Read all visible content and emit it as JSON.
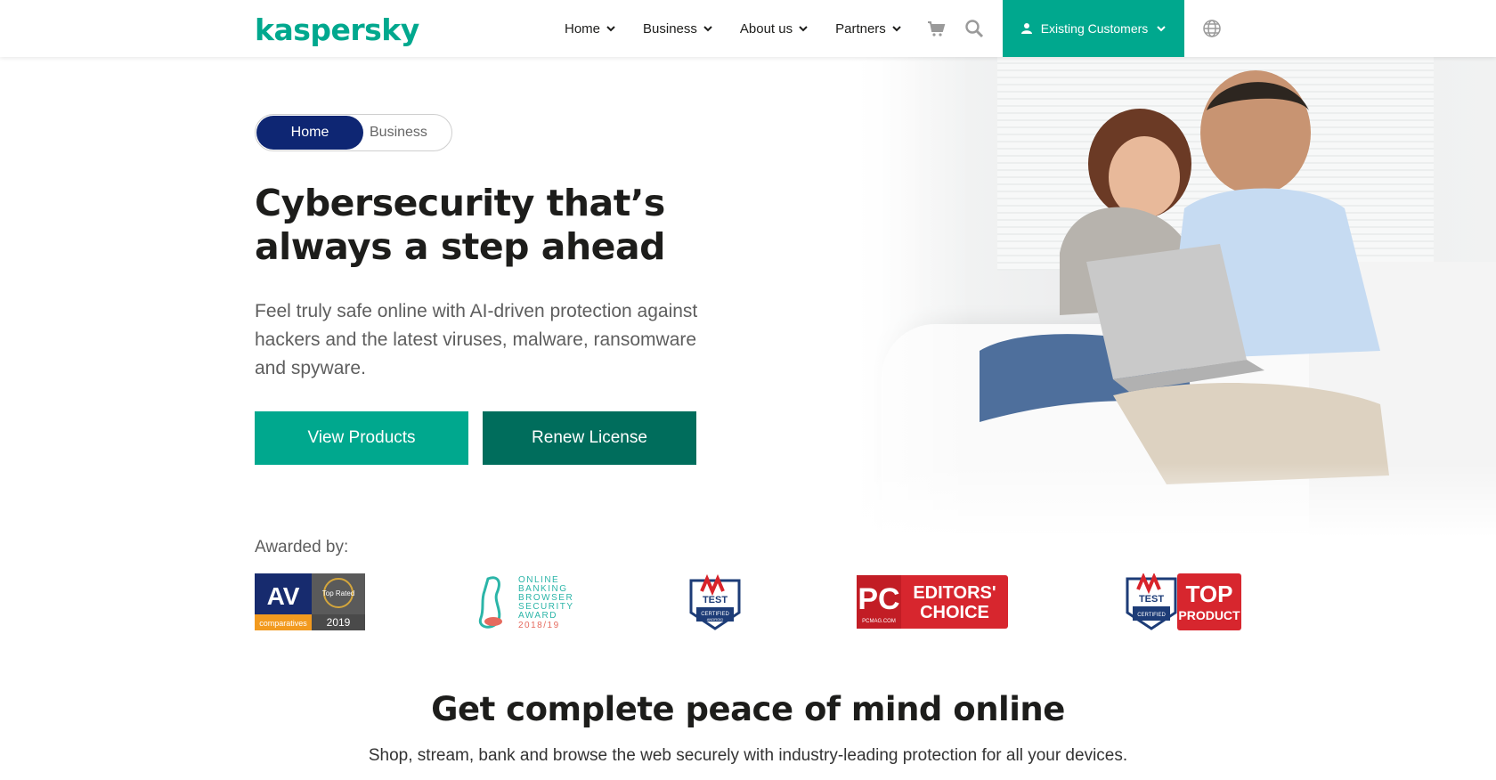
{
  "header": {
    "logo": "kaspersky",
    "nav": [
      {
        "label": "Home"
      },
      {
        "label": "Business"
      },
      {
        "label": "About us"
      },
      {
        "label": "Partners"
      }
    ],
    "existing_customers": "Existing Customers",
    "accent": "#00a88e"
  },
  "hero": {
    "toggle": {
      "active": "Home",
      "inactive": "Business"
    },
    "headline": "Cybersecurity that’s always a step ahead",
    "subtitle": "Feel truly safe online with AI-driven protection against hackers and the latest viruses, malware, ransomware and spyware.",
    "buttons": {
      "view": "View Products",
      "renew": "Renew License"
    }
  },
  "awards": {
    "label": "Awarded by:",
    "items": [
      {
        "name": "AV comparatives",
        "top": "AV",
        "sub": "comparatives",
        "badge": "Top Rated",
        "year": "2019"
      },
      {
        "name": "Online Banking Browser Security Award",
        "lines": [
          "ONLINE",
          "BANKING",
          "BROWSER",
          "SECURITY",
          "AWARD",
          "2018/19"
        ]
      },
      {
        "name": "AV-TEST Certified Android",
        "top": "TEST",
        "sub": "CERTIFIED",
        "platform": "ANDROID"
      },
      {
        "name": "PC Editors' Choice",
        "pc": "PC",
        "line1": "EDITORS'",
        "line2": "CHOICE",
        "site": "PCMAG.COM"
      },
      {
        "name": "AV-TEST Top Product",
        "top": "TEST",
        "sub": "CERTIFIED",
        "line1": "TOP",
        "line2": "PRODUCT"
      }
    ]
  },
  "section": {
    "title": "Get complete peace of mind online",
    "subtitle": "Shop, stream, bank and browse the web securely with industry-leading protection for all your devices."
  }
}
